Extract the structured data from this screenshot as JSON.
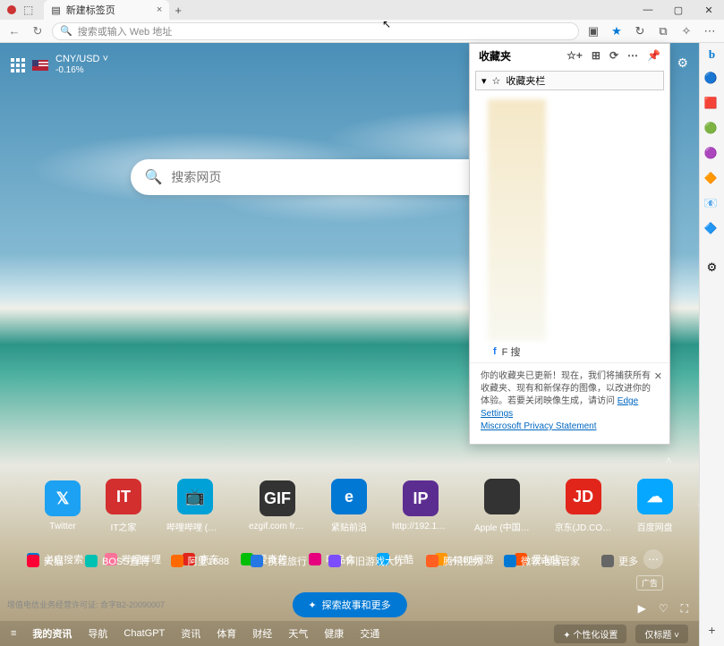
{
  "titlebar": {
    "tab_title": "新建标签页",
    "tab_close": "×",
    "newtab": "+",
    "win": {
      "min": "—",
      "max": "▢",
      "close": "✕"
    }
  },
  "toolbar": {
    "back": "←",
    "forward": "→",
    "reload": "↻",
    "url_icon": "🔍",
    "url_placeholder": "搜索或输入 Web 地址",
    "icons": {
      "split": "▣",
      "star": "★",
      "refresh": "↻",
      "ext": "⧉",
      "collect": "✧",
      "menu": "⋯"
    }
  },
  "favorites": {
    "title": "收藏夹",
    "head_icons": {
      "add": "☆+",
      "folder": "⊞",
      "sync": "⟳",
      "more": "⋯",
      "pin": "📌"
    },
    "bar": {
      "chev": "▾",
      "star": "☆",
      "label": "收藏夹栏"
    },
    "item_f": {
      "icon": "f",
      "label": "F 搜"
    },
    "msg_text": "你的收藏夹已更新！现在，我们将捕获所有收藏夹、现有和新保存的图像，以改进你的体验。若要关闭映像生成，请访问 ",
    "edge_link": "Edge Settings",
    "privacy_link": "Miscrosoft Privacy Statement",
    "msg_close": "✕"
  },
  "sidebar": {
    "bing": "b",
    "gear": "⚙",
    "icons": [
      {
        "glyph": "🔵",
        "color": "#0078d4",
        "name": "side-chat"
      },
      {
        "glyph": "🟥",
        "color": "#d83b01",
        "name": "side-shopping"
      },
      {
        "glyph": "🟢",
        "color": "#107c10",
        "name": "side-tools"
      },
      {
        "glyph": "🟣",
        "color": "#8661c5",
        "name": "side-games"
      },
      {
        "glyph": "🔶",
        "color": "#d29200",
        "name": "side-office"
      },
      {
        "glyph": "📧",
        "color": "#0078d4",
        "name": "side-outlook"
      },
      {
        "glyph": "🔷",
        "color": "#0078d4",
        "name": "side-drop"
      }
    ],
    "plus": "+"
  },
  "ntp": {
    "currency": {
      "pair": "CNY/USD",
      "chg": "-0.16%",
      "chev": "˅"
    },
    "search_placeholder": "搜索网页",
    "gear": "⚙",
    "chev_up": "˄",
    "tile_add": "+"
  },
  "tiles": [
    {
      "label": "Twitter",
      "bg": "#1da1f2",
      "glyph": "𝕏"
    },
    {
      "label": "IT之家",
      "bg": "#d32f2f",
      "glyph": "IT"
    },
    {
      "label": "哔哩哔哩 (゜…",
      "bg": "#00a1d6",
      "glyph": "📺"
    },
    {
      "label": "ezgif.com fre…",
      "bg": "#333",
      "glyph": "GIF"
    },
    {
      "label": "紧贴前沿",
      "bg": "#0078d4",
      "glyph": "e"
    },
    {
      "label": "http://192.16…",
      "bg": "#5c2d91",
      "glyph": "IP"
    },
    {
      "label": "Apple (中国…",
      "bg": "#333",
      "glyph": ""
    },
    {
      "label": "京东(JD.COM)",
      "bg": "#e1251b",
      "glyph": "JD"
    },
    {
      "label": "百度网盘",
      "bg": "#06a7ff",
      "glyph": "☁"
    }
  ],
  "links_row1": [
    {
      "label": "必应搜索",
      "bg": "#0078d4"
    },
    {
      "label": "哔哩哔哩",
      "bg": "#fb7299"
    },
    {
      "label": "京东",
      "bg": "#e1251b"
    },
    {
      "label": "爱奇艺",
      "bg": "#00be06"
    },
    {
      "label": "唯品会",
      "bg": "#e6007e"
    },
    {
      "label": "优酷",
      "bg": "#00a8ff"
    },
    {
      "label": "4366网游",
      "bg": "#ff9500"
    },
    {
      "label": "爱淘宝",
      "bg": "#ff5000"
    }
  ],
  "links_row2": [
    {
      "label": "天猫",
      "bg": "#ff0036"
    },
    {
      "label": "BOSS直聘",
      "bg": "#00c2b3"
    },
    {
      "label": "阿里1688",
      "bg": "#ff6a00"
    },
    {
      "label": "携程旅行",
      "bg": "#2577e3"
    },
    {
      "label": "怀旧游戏大厅",
      "bg": "#7b4dff"
    },
    {
      "label": "腾讯视频",
      "bg": "#ff6022"
    },
    {
      "label": "微软电脑管家",
      "bg": "#0078d4"
    },
    {
      "label": "更多",
      "bg": "#666"
    }
  ],
  "links_more": "⋯",
  "ad_chip": "广告",
  "explore": {
    "icon": "✦",
    "label": "探索故事和更多"
  },
  "legal": "增值电信业务经营许可证: 合字B2-20090007",
  "media": {
    "play": "▶",
    "like": "♡",
    "full": "⛶"
  },
  "navtabs": [
    "我的资讯",
    "导航",
    "ChatGPT",
    "资讯",
    "体育",
    "财经",
    "天气",
    "健康",
    "交通"
  ],
  "navtabs_leading": "≡",
  "sel_personal": "✦ 个性化设置",
  "sel_title": "仅标题",
  "sel_chev": "˅"
}
